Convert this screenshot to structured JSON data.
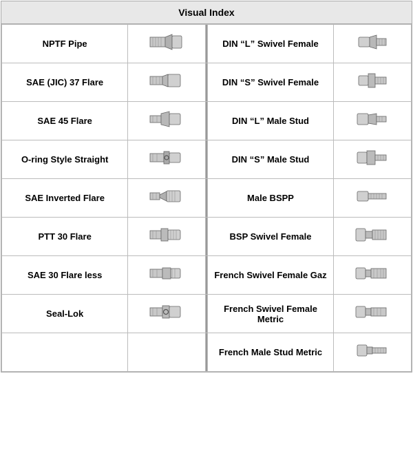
{
  "title": "Visual Index",
  "rows": [
    {
      "left_label": "NPTF Pipe",
      "left_shape": "nptf",
      "right_label": "DIN “L” Swivel Female",
      "right_shape": "din_l_swivel_female"
    },
    {
      "left_label": "SAE (JIC) 37 Flare",
      "left_shape": "sae_jic_37",
      "right_label": "DIN “S” Swivel Female",
      "right_shape": "din_s_swivel_female"
    },
    {
      "left_label": "SAE 45 Flare",
      "left_shape": "sae_45",
      "right_label": "DIN “L” Male Stud",
      "right_shape": "din_l_male_stud"
    },
    {
      "left_label": "O-ring Style Straight",
      "left_shape": "oring_straight",
      "right_label": "DIN “S” Male Stud",
      "right_shape": "din_s_male_stud"
    },
    {
      "left_label": "SAE Inverted Flare",
      "left_shape": "sae_inverted",
      "right_label": "Male BSPP",
      "right_shape": "male_bspp"
    },
    {
      "left_label": "PTT 30 Flare",
      "left_shape": "ptt_30",
      "right_label": "BSP Swivel Female",
      "right_shape": "bsp_swivel_female"
    },
    {
      "left_label": "SAE 30 Flare less",
      "left_shape": "sae_30_flareless",
      "right_label": "French Swivel Female Gaz",
      "right_shape": "french_swivel_female_gaz"
    },
    {
      "left_label": "Seal-Lok",
      "left_shape": "seal_lok",
      "right_label": "French Swivel Female Metric",
      "right_shape": "french_swivel_female_metric"
    },
    {
      "left_label": "",
      "left_shape": "empty",
      "right_label": "French Male Stud Metric",
      "right_shape": "french_male_stud_metric"
    }
  ]
}
